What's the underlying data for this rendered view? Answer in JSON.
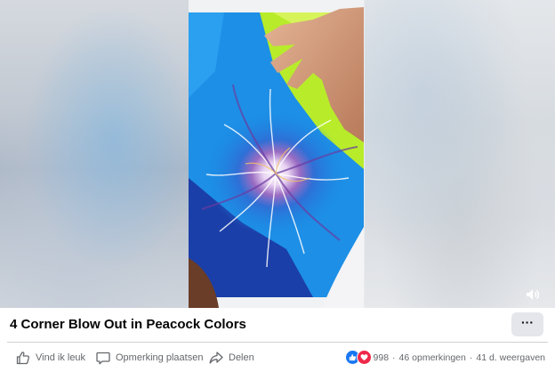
{
  "video": {
    "title": "4 Corner Blow Out in Peacock Colors",
    "volume_icon": "speaker-icon"
  },
  "menu": {
    "more_label": "···"
  },
  "actions": {
    "like_label": "Vind ik leuk",
    "comment_label": "Opmerking plaatsen",
    "share_label": "Delen"
  },
  "stats": {
    "reaction_count": "998",
    "comments": "46 opmerkingen",
    "dot": "·",
    "views": "41 d. weergaven"
  },
  "colors": {
    "like_blue": "#1877f2",
    "love_red": "#f02849",
    "secondary_text": "#65676b",
    "button_bg": "#e4e6eb"
  }
}
